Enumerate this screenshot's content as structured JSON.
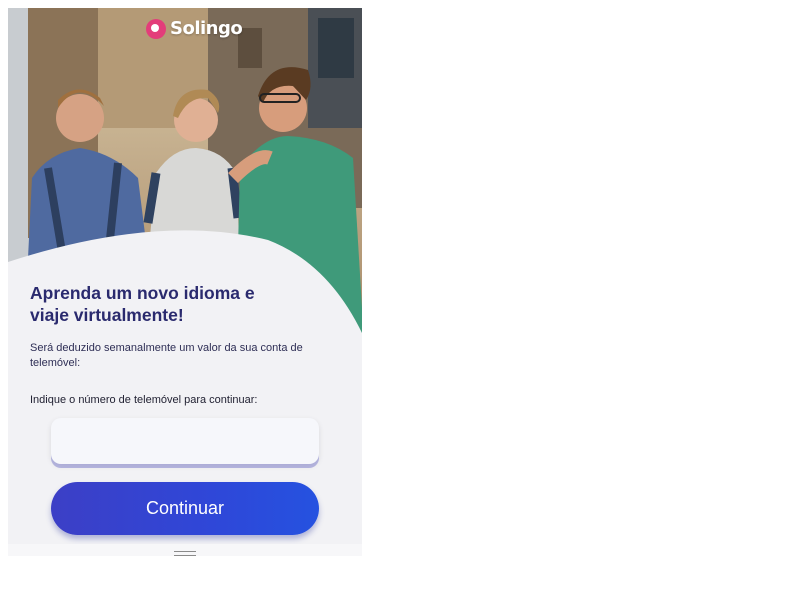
{
  "app": {
    "brand": "Solingo",
    "brand_color": "#e33d7a"
  },
  "hero": {
    "image": "three-friends-laughing-street-photo"
  },
  "main": {
    "headline": "Aprenda um novo idioma e viaje virtualmente!",
    "description": "Será deduzido semanalmente um valor da sua conta de telemóvel:",
    "phone_label": "Indique o número de telemóvel para continuar:"
  },
  "form": {
    "phone_value": "",
    "phone_placeholder": "",
    "continue_label": "Continuar"
  },
  "colors": {
    "headline": "#2a2a6e",
    "button_start": "#3c3fc6",
    "button_end": "#2552e0",
    "background": "#f2f2f5"
  },
  "icons": {
    "logo": "solingo-logo-icon",
    "handle": "drag-handle-icon"
  }
}
